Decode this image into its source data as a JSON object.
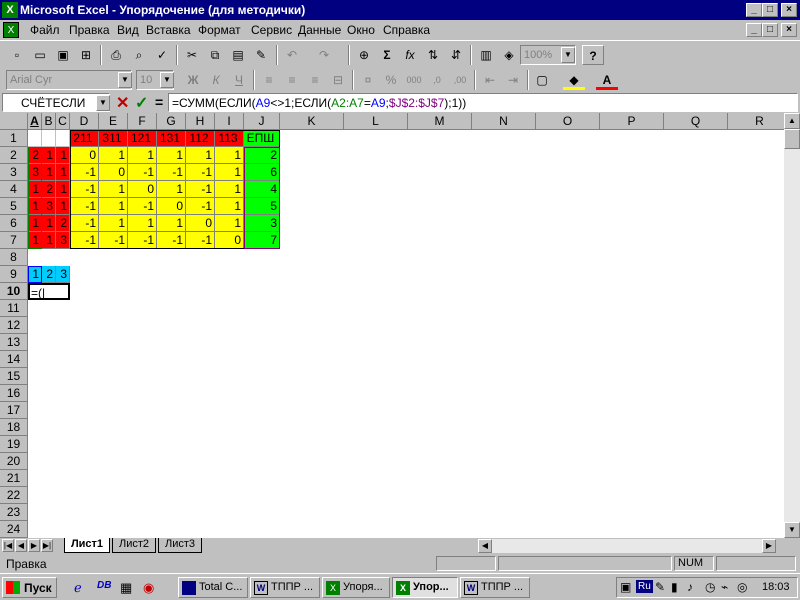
{
  "window": {
    "title": "Microsoft Excel - Упорядочение (для методички)",
    "min_label": "_",
    "max_label": "□",
    "close_label": "×"
  },
  "menu": [
    "Файл",
    "Правка",
    "Вид",
    "Вставка",
    "Формат",
    "Сервис",
    "Данные",
    "Окно",
    "Справка"
  ],
  "toolbar": {
    "zoom": "100%",
    "font": "Arial Cyr",
    "font_size": "10",
    "sigma_label": "Σ",
    "fx_label": "fx",
    "bold_label": "Ж",
    "italic_label": "К",
    "underline_label": "Ч",
    "percent_label": "%",
    "thousands_label": "000",
    "dec_inc_label": ",0",
    "dec_dec_label": ",00",
    "help_label": "?"
  },
  "formula_bar": {
    "name_box": "СЧЁТЕСЛИ",
    "cancel_label": "✕",
    "confirm_label": "✓",
    "equals_label": "=",
    "formula_parts": [
      {
        "text": "=СУММ(ЕСЛИ(",
        "color": "#000000"
      },
      {
        "text": "A9",
        "color": "#0000ff"
      },
      {
        "text": "<>1;ЕСЛИ(",
        "color": "#000000"
      },
      {
        "text": "A2:A7",
        "color": "#008000"
      },
      {
        "text": "=",
        "color": "#000000"
      },
      {
        "text": "A9",
        "color": "#0000ff"
      },
      {
        "text": ";",
        "color": "#000000"
      },
      {
        "text": "$J$2:$J$7",
        "color": "#800080"
      },
      {
        "text": ");1))",
        "color": "#000000"
      }
    ]
  },
  "columns": [
    "A",
    "B",
    "C",
    "D",
    "E",
    "F",
    "G",
    "H",
    "I",
    "J",
    "K",
    "L",
    "M",
    "N",
    "O",
    "P",
    "Q",
    "R"
  ],
  "rows": [
    "1",
    "2",
    "3",
    "4",
    "5",
    "6",
    "7",
    "8",
    "9",
    "10",
    "11",
    "12",
    "13",
    "14",
    "15",
    "16",
    "17",
    "18",
    "19",
    "20",
    "21",
    "22",
    "23",
    "24"
  ],
  "cells": {
    "header_row": [
      "",
      "",
      "",
      "211",
      "311",
      "121",
      "131",
      "112",
      "113",
      "ЕПШ"
    ],
    "data_rows": [
      [
        "2",
        "1",
        "1",
        "0",
        "1",
        "1",
        "1",
        "1",
        "1",
        "2"
      ],
      [
        "3",
        "1",
        "1",
        "-1",
        "0",
        "-1",
        "-1",
        "-1",
        "1",
        "6"
      ],
      [
        "1",
        "2",
        "1",
        "-1",
        "1",
        "0",
        "1",
        "-1",
        "1",
        "4"
      ],
      [
        "1",
        "3",
        "1",
        "-1",
        "1",
        "-1",
        "0",
        "-1",
        "1",
        "5"
      ],
      [
        "1",
        "1",
        "2",
        "-1",
        "1",
        "1",
        "1",
        "0",
        "1",
        "3"
      ],
      [
        "1",
        "1",
        "3",
        "-1",
        "-1",
        "-1",
        "-1",
        "-1",
        "0",
        "7"
      ]
    ],
    "row9": [
      "1",
      "2",
      "3"
    ],
    "row10_edit": "=(|"
  },
  "colors": {
    "red": "#ff0000",
    "yellow": "#ffff00",
    "green": "#00ff00",
    "cyan": "#00ccff",
    "title_bar": "#000080"
  },
  "sheets": [
    "Лист1",
    "Лист2",
    "Лист3"
  ],
  "status": {
    "mode": "Правка",
    "num": "NUM"
  },
  "taskbar": {
    "start": "Пуск",
    "tasks": [
      "Total C...",
      "ТППР ...",
      "Упоря...",
      "Упор...",
      "ТППР ..."
    ],
    "lang": "Ru",
    "clock": "18:03"
  }
}
